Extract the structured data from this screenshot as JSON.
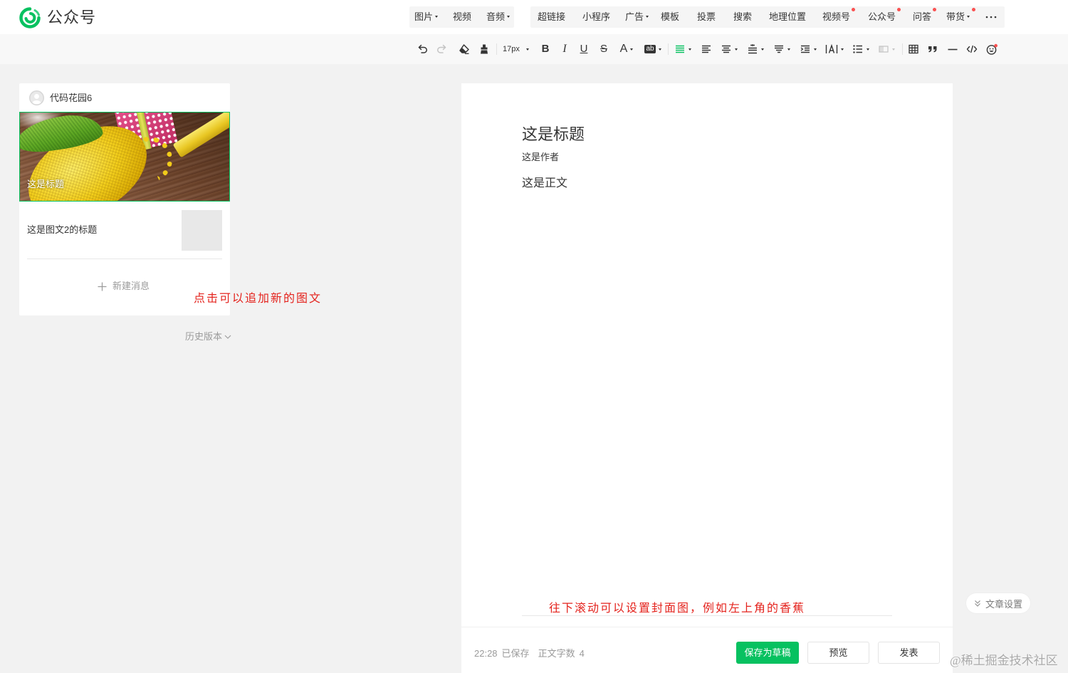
{
  "app": {
    "logo_text": "公众号",
    "logo_icon": "wechat-official-account-logo-icon"
  },
  "header": {
    "media_menu": [
      {
        "label": "图片",
        "has_dropdown": true
      },
      {
        "label": "视频"
      },
      {
        "label": "音频",
        "has_dropdown": true
      }
    ],
    "insert_menu": [
      {
        "label": "超链接"
      },
      {
        "label": "小程序"
      },
      {
        "label": "广告",
        "has_dropdown": true
      },
      {
        "label": "模板"
      },
      {
        "label": "投票"
      },
      {
        "label": "搜索"
      },
      {
        "label": "地理位置"
      },
      {
        "label": "视频号",
        "badge": true
      },
      {
        "label": "公众号",
        "badge": true
      },
      {
        "label": "问答",
        "badge": true
      },
      {
        "label": "带货",
        "has_dropdown": true,
        "badge": true
      }
    ],
    "more_icon": "more-icon"
  },
  "toolbar": {
    "font_size": "17px",
    "glyphs": {
      "bold": "B",
      "italic": "I",
      "underline": "U",
      "strikethrough": "S",
      "font_color": "A",
      "background_color": "ab"
    },
    "icons": [
      "undo-icon",
      "redo-icon",
      "format-painter-icon",
      "clear-format-icon",
      "align-left-icon",
      "align-justify-icon",
      "align-center-icon",
      "line-height-icon",
      "paragraph-spacing-icon",
      "indent-icon",
      "letter-spacing-icon",
      "list-icon",
      "border-icon",
      "table-icon",
      "blockquote-icon",
      "horizontal-rule-icon",
      "code-icon",
      "emoji-icon"
    ]
  },
  "sidebar": {
    "account_name": "代码花园6",
    "articles": [
      {
        "title": "这是标题",
        "selected": true
      },
      {
        "title": "这是图文2的标题"
      }
    ],
    "new_message_label": "新建消息",
    "history_label": "历史版本"
  },
  "annotations": {
    "add_article": "点击可以追加新的图文",
    "set_cover": "往下滚动可以设置封面图，例如左上角的香蕉"
  },
  "editor": {
    "title": "这是标题",
    "author": "这是作者",
    "body": "这是正文"
  },
  "footer": {
    "save_time": "22:28",
    "save_status": "已保存",
    "word_count_label": "正文字数",
    "word_count": "4",
    "save_draft_label": "保存为草稿",
    "preview_label": "预览",
    "publish_label": "发表"
  },
  "article_settings_label": "文章设置",
  "watermark": "@稀土掘金技术社区",
  "colors": {
    "accent": "#07c160",
    "badge": "#fa5151",
    "annotation": "#e4231d",
    "background": "#f2f2f2"
  }
}
